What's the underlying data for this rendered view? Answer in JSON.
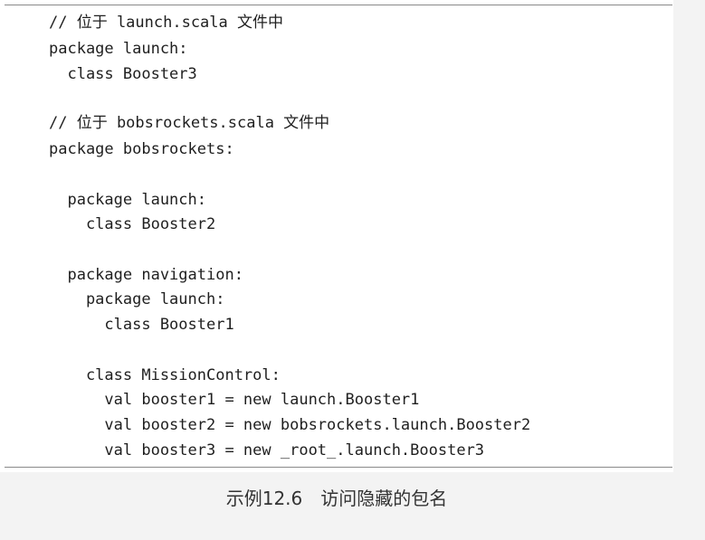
{
  "code_lines": [
    "// 位于 launch.scala 文件中",
    "package launch:",
    "  class Booster3",
    "",
    "// 位于 bobsrockets.scala 文件中",
    "package bobsrockets:",
    "",
    "  package launch:",
    "    class Booster2",
    "",
    "  package navigation:",
    "    package launch:",
    "      class Booster1",
    "",
    "    class MissionControl:",
    "      val booster1 = new launch.Booster1",
    "      val booster2 = new bobsrockets.launch.Booster2",
    "      val booster3 = new _root_.launch.Booster3"
  ],
  "caption": "示例12.6　访问隐藏的包名"
}
